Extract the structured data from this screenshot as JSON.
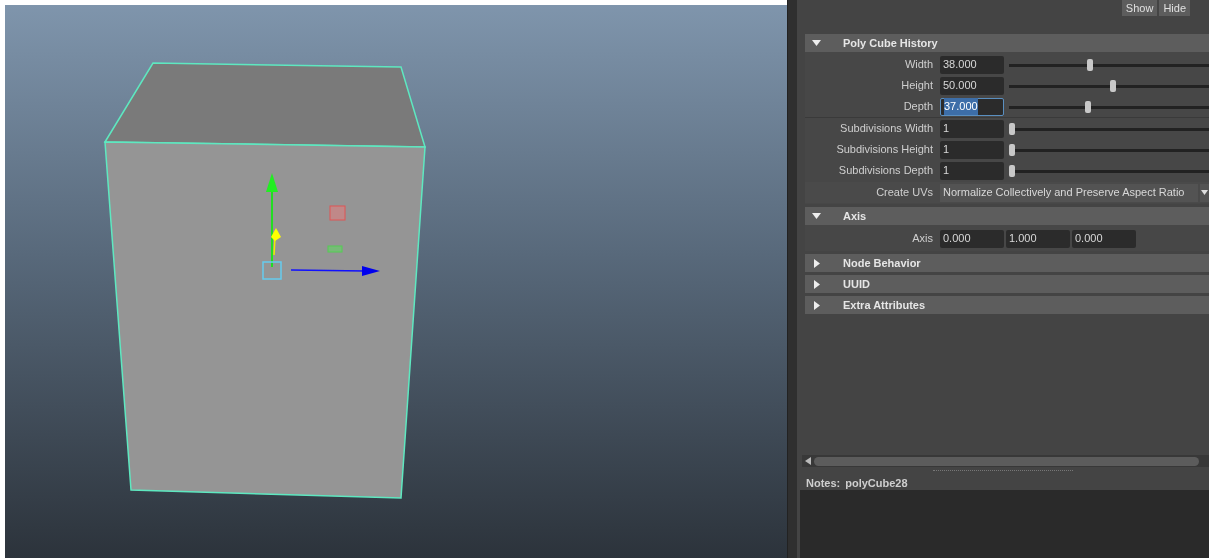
{
  "header_buttons": [
    "Show",
    "Hide"
  ],
  "sections": [
    {
      "title": "Poly Cube History",
      "expanded": true,
      "rows": [
        {
          "kind": "slider",
          "label": "Width",
          "value": "38.000",
          "level": 0.4,
          "focused": false
        },
        {
          "kind": "slider",
          "label": "Height",
          "value": "50.000",
          "level": 0.52,
          "focused": false
        },
        {
          "kind": "slider",
          "label": "Depth",
          "value": "37.000",
          "level": 0.39,
          "focused": true
        },
        {
          "kind": "divider"
        },
        {
          "kind": "slider",
          "label": "Subdivisions Width",
          "value": "1",
          "level": 0,
          "focused": false
        },
        {
          "kind": "slider",
          "label": "Subdivisions Height",
          "value": "1",
          "level": 0,
          "focused": false
        },
        {
          "kind": "slider",
          "label": "Subdivisions Depth",
          "value": "1",
          "level": 0,
          "focused": false
        },
        {
          "kind": "dropdown",
          "label": "Create UVs",
          "value": "Normalize Collectively and Preserve Aspect Ratio"
        }
      ]
    },
    {
      "title": "Axis",
      "expanded": true,
      "rows": [
        {
          "kind": "vector",
          "label": "Axis",
          "values": [
            "0.000",
            "1.000",
            "0.000"
          ]
        }
      ]
    },
    {
      "title": "Node Behavior",
      "expanded": false
    },
    {
      "title": "UUID",
      "expanded": false
    },
    {
      "title": "Extra Attributes",
      "expanded": false
    }
  ],
  "notes": {
    "label": "Notes:",
    "node": "polyCube28"
  }
}
